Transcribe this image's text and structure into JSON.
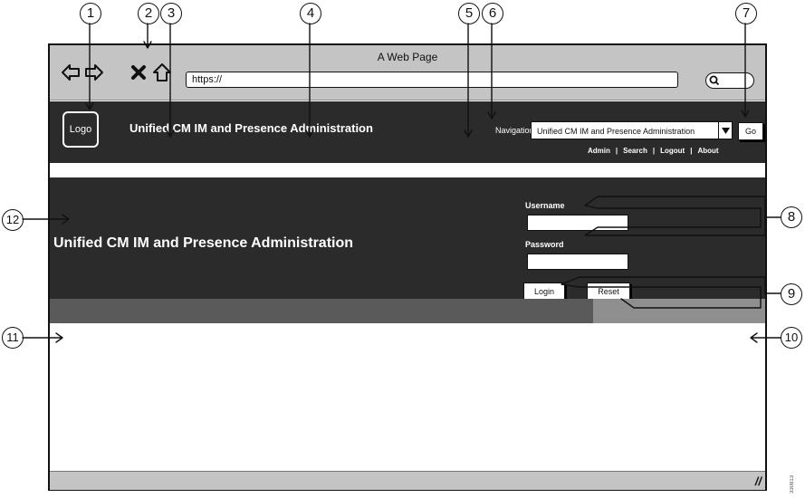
{
  "browser": {
    "window_title": "A Web Page",
    "url": "https://",
    "nav_icons": [
      "back-arrow-icon",
      "forward-arrow-icon",
      "stop-icon",
      "home-icon"
    ],
    "search_icon": "search-icon"
  },
  "header": {
    "logo_label": "Logo",
    "app_title": "Unified CM IM and Presence Administration",
    "navigation_label": "Navigation",
    "navigation_selected": "Unified CM IM and Presence Administration",
    "go_label": "Go",
    "links": [
      "Admin",
      "Search",
      "Logout",
      "About"
    ]
  },
  "login": {
    "app_title": "Unified CM IM and Presence Administration",
    "username_label": "Username",
    "password_label": "Password",
    "username_value": "",
    "password_value": "",
    "login_label": "Login",
    "reset_label": "Reset"
  },
  "progress": {
    "fraction": 0.76
  },
  "callouts": [
    "1",
    "2",
    "3",
    "4",
    "5",
    "6",
    "7",
    "8",
    "9",
    "10",
    "11",
    "12"
  ],
  "edge_id": "330813",
  "colors": {
    "dark_band": "#2b2b2b",
    "chrome_gray": "#c4c4c4",
    "progress_dark": "#5a5a5a",
    "progress_light": "#8f8f8f"
  }
}
